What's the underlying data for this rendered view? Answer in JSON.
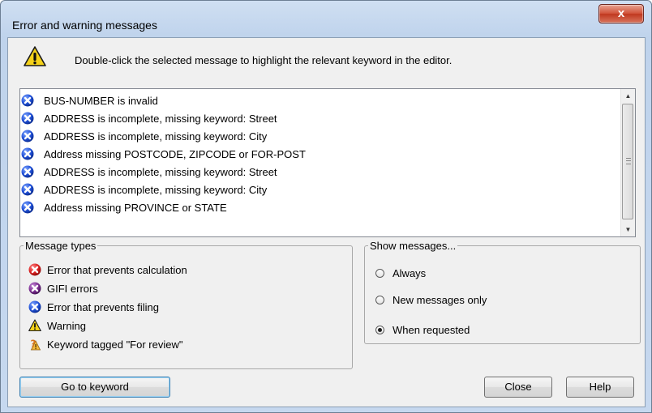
{
  "window": {
    "title": "Error and warning messages",
    "close_glyph": "x"
  },
  "info": {
    "icon": "warning-icon",
    "text": "Double-click the selected message to highlight the relevant keyword in the editor."
  },
  "messages": [
    {
      "icon": "blue-x-icon",
      "text": "BUS-NUMBER  is invalid"
    },
    {
      "icon": "blue-x-icon",
      "text": "ADDRESS is incomplete, missing keyword: Street"
    },
    {
      "icon": "blue-x-icon",
      "text": "ADDRESS is incomplete, missing keyword: City"
    },
    {
      "icon": "blue-x-icon",
      "text": "Address missing POSTCODE, ZIPCODE or FOR-POST"
    },
    {
      "icon": "blue-x-icon",
      "text": "ADDRESS is incomplete, missing keyword: Street"
    },
    {
      "icon": "blue-x-icon",
      "text": "ADDRESS is incomplete, missing keyword: City"
    },
    {
      "icon": "blue-x-icon",
      "text": "Address missing PROVINCE or STATE"
    }
  ],
  "message_types": {
    "legend": "Message types",
    "items": [
      {
        "icon": "red-x-icon",
        "label": "Error that prevents calculation"
      },
      {
        "icon": "purple-x-icon",
        "label": "GIFI errors"
      },
      {
        "icon": "blue-x-icon",
        "label": "Error that prevents filing"
      },
      {
        "icon": "warning-icon",
        "label": "Warning"
      },
      {
        "icon": "review-icon",
        "label": "Keyword tagged \"For review\""
      }
    ]
  },
  "show_messages": {
    "legend": "Show messages...",
    "options": [
      {
        "label": "Always",
        "checked": false
      },
      {
        "label": "New messages only",
        "checked": false
      },
      {
        "label": "When requested",
        "checked": true
      }
    ]
  },
  "buttons": {
    "goto": "Go to keyword",
    "close": "Close",
    "help": "Help"
  },
  "colors": {
    "error_blue": "#1f4fd6",
    "error_red": "#d81e1e",
    "error_purple": "#7b2d90",
    "warning_yellow": "#f5d21a"
  }
}
